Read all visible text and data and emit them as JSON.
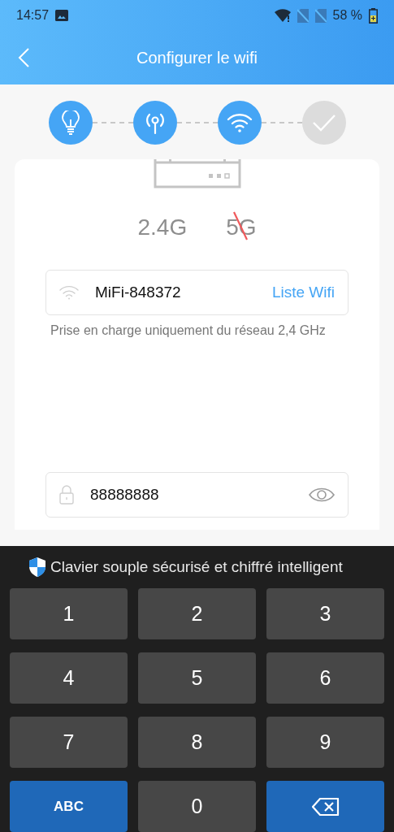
{
  "status_bar": {
    "time": "14:57",
    "battery": "58 %"
  },
  "header": {
    "title": "Configurer le wifi"
  },
  "steps": [
    {
      "kind": "bulb",
      "done": true
    },
    {
      "kind": "antenna",
      "done": true
    },
    {
      "kind": "wifi",
      "done": true
    },
    {
      "kind": "check",
      "done": false
    }
  ],
  "bands": [
    {
      "label": "2.4G",
      "supported": true
    },
    {
      "label": "5G",
      "supported": false
    }
  ],
  "wifi_field": {
    "value": "MiFi-848372",
    "action": "Liste Wifi"
  },
  "hint": "Prise en charge uniquement du réseau 2,4 GHz",
  "password_field": {
    "value": "88888888"
  },
  "keyboard": {
    "title": "Clavier souple sécurisé et chiffré intelligent",
    "keys": [
      {
        "kind": "digit",
        "label": "1"
      },
      {
        "kind": "digit",
        "label": "2"
      },
      {
        "kind": "digit",
        "label": "3"
      },
      {
        "kind": "digit",
        "label": "4"
      },
      {
        "kind": "digit",
        "label": "5"
      },
      {
        "kind": "digit",
        "label": "6"
      },
      {
        "kind": "digit",
        "label": "7"
      },
      {
        "kind": "digit",
        "label": "8"
      },
      {
        "kind": "digit",
        "label": "9"
      },
      {
        "kind": "mode",
        "label": "ABC"
      },
      {
        "kind": "digit",
        "label": "0"
      },
      {
        "kind": "backspace"
      }
    ]
  }
}
